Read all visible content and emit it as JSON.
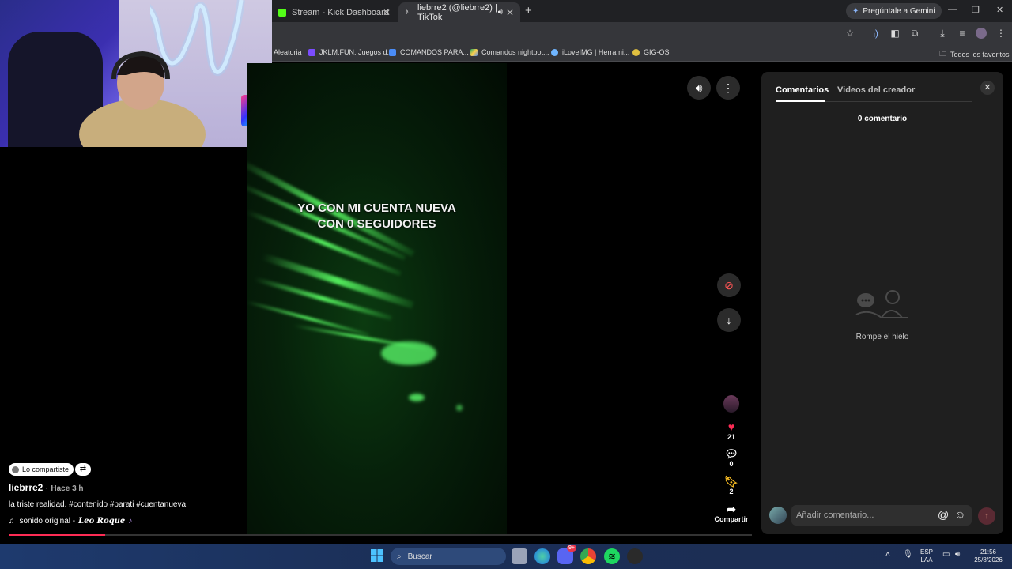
{
  "browser": {
    "tabs": [
      {
        "label": "Stream - Kick Dashboard",
        "active": false
      },
      {
        "label": "liebrre2 (@liebrre2) | TikTok",
        "active": true
      }
    ],
    "gemini_label": "Pregúntale a Gemini",
    "bookmarks": [
      {
        "label": "Aleatoria"
      },
      {
        "label": "JKLM.FUN: Juegos d..."
      },
      {
        "label": "COMANDOS PARA..."
      },
      {
        "label": "Comandos nightbot..."
      },
      {
        "label": "iLoveIMG | Herrami..."
      },
      {
        "label": "GIG-OS"
      }
    ],
    "all_favorites": "Todos los favoritos"
  },
  "video": {
    "caption_line1": "YO CON MI CUENTA NUEVA",
    "caption_line2": "CON 0 SEGUIDORES",
    "progress_fraction": 0.13
  },
  "actions": {
    "likes": "21",
    "comments": "0",
    "saves": "2",
    "share_label": "Compartir"
  },
  "post": {
    "shared_badge": "Lo compartiste",
    "author": "liebrre2",
    "posted_ago": "Hace 3 h",
    "description": "la triste realidad. #contenido #parati #cuentanueva",
    "sound_prefix": "sonido original - ",
    "sound_artist": "𝑳𝒆𝒐 𝑹𝒐𝒒𝒖𝒆"
  },
  "comments_panel": {
    "tab_comments": "Comentarios",
    "tab_creator_videos": "Videos del creador",
    "count_label": "0 comentario",
    "empty_text": "Rompe el hielo",
    "input_placeholder": "Añadir comentario..."
  },
  "taskbar": {
    "search_label": "Buscar",
    "lang_top": "ESP",
    "lang_bottom": "LAA",
    "time": "21:56",
    "date": "25/8/2026",
    "discord_badge": "9+"
  }
}
